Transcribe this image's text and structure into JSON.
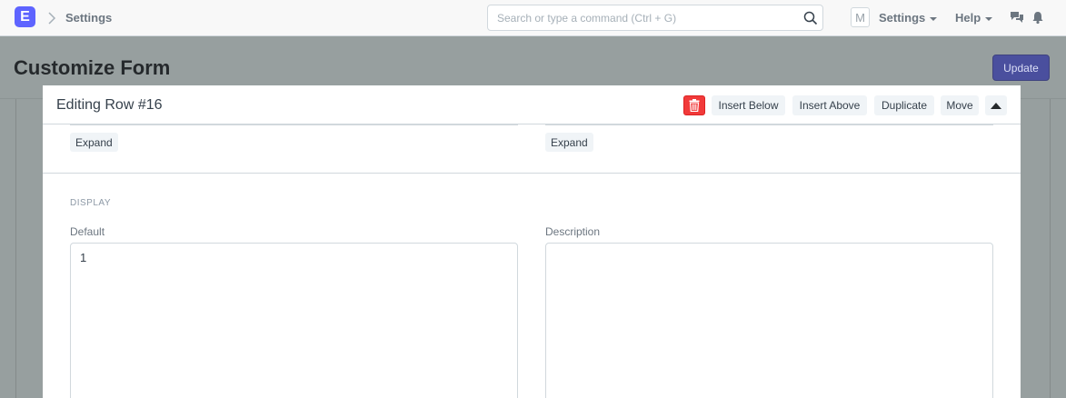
{
  "navbar": {
    "logo_letter": "E",
    "breadcrumb": "Settings",
    "search_placeholder": "Search or type a command (Ctrl + G)",
    "avatar_letter": "M",
    "settings_label": "Settings",
    "help_label": "Help"
  },
  "page": {
    "title": "Customize Form",
    "update_label": "Update"
  },
  "panel": {
    "title": "Editing Row #16",
    "buttons": {
      "insert_below": "Insert Below",
      "insert_above": "Insert Above",
      "duplicate": "Duplicate",
      "move": "Move"
    },
    "expand_left": "Expand",
    "expand_right": "Expand",
    "section_label": "DISPLAY",
    "default_label": "Default",
    "default_value": "1",
    "description_label": "Description",
    "description_value": ""
  },
  "colors": {
    "brand": "#5e64ff",
    "danger": "#f13a3a",
    "primary_dimmed": "#4a4f9e"
  }
}
